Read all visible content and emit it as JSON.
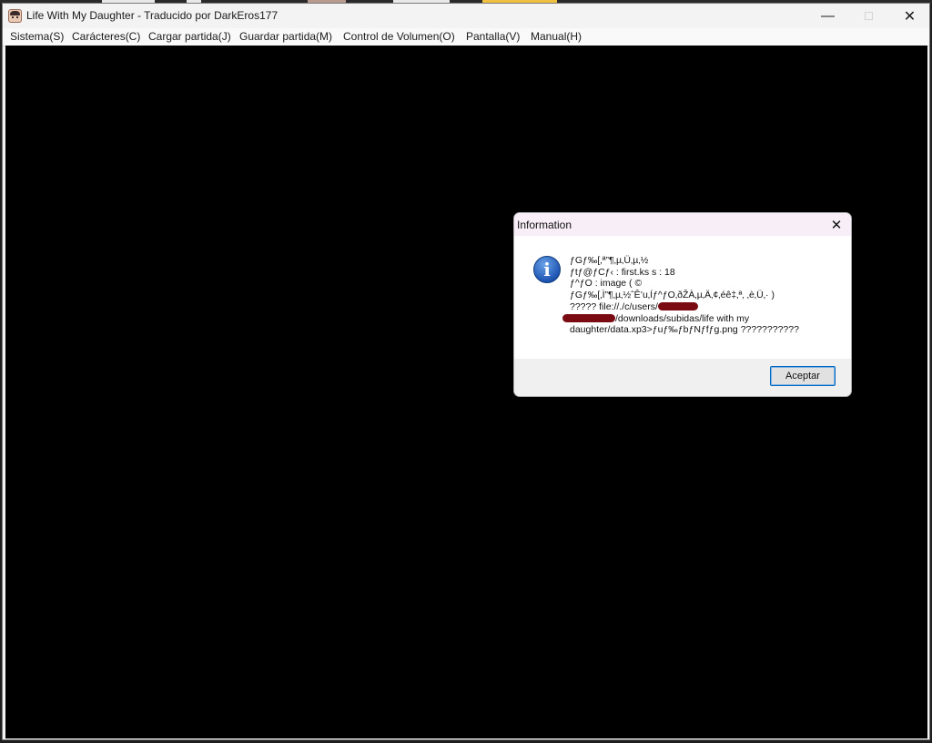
{
  "window": {
    "title": "Life With My Daughter - Traducido por DarkEros177",
    "controls": {
      "minimize": "—",
      "maximize": "☐",
      "close": "✕"
    }
  },
  "menubar": {
    "items": [
      "Sistema(S)",
      "Carácteres(C)",
      "Cargar partida(J)",
      "Guardar partida(M)",
      "Control de Volumen(O)",
      "Pantalla(V)",
      "Manual(H)"
    ]
  },
  "dialog": {
    "title": "Information",
    "close": "✕",
    "icon": "info-icon",
    "lines": {
      "l1": "ƒGƒ‰[‚ª”­¶‚µ‚Ü‚µ‚½",
      "l2": "ƒtƒ@ƒCƒ‹ : first.ks   s : 18",
      "l3": "ƒ^ƒO : image ( ©",
      "l4": "ƒGƒ‰[‚Ì”­¶‚µ‚½ˆÊ’u‚Íƒ^ƒO‚ðŽÀ‚µ‚Ä‚¢‚éê‡‚ª‚ ‚è‚Ü‚· )",
      "l5a": "????? file://./c/users/",
      "l6b": "/downloads/subidas/life with my",
      "l7": "daughter/data.xp3>ƒuƒ‰ƒbƒNƒfƒg.png ???????????"
    },
    "ok_label": "Aceptar",
    "redaction_color": "#7a0b12"
  },
  "colors": {
    "canvas": "#000000",
    "dialog_title_bg": "#f7eef7",
    "button_border": "#0067c0"
  }
}
